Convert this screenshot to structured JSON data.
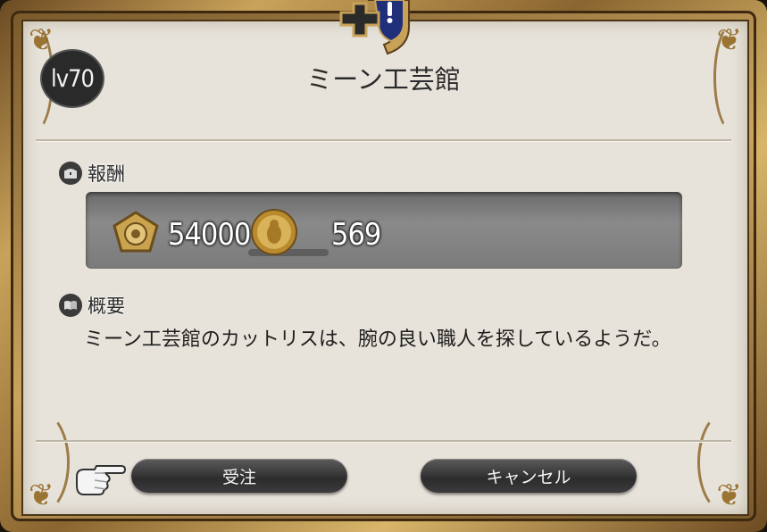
{
  "window": {
    "title": "ミーン工芸館",
    "level_label": "lv70"
  },
  "reward": {
    "heading": "報酬",
    "heading_icon": "chest-icon",
    "items": [
      {
        "icon": "gil-medal-icon",
        "value": "54000"
      },
      {
        "icon": "gold-coin-icon",
        "value": "569"
      }
    ]
  },
  "summary": {
    "heading": "概要",
    "heading_icon": "book-icon",
    "text": "ミーン工芸館のカットリスは、腕の良い職人を探しているようだ。"
  },
  "actions": {
    "accept_label": "受注",
    "cancel_label": "キャンセル"
  },
  "colors": {
    "panel": "#e7e3da",
    "frame_gold": "#c9a25a",
    "button_dark": "#2c2c2c"
  }
}
